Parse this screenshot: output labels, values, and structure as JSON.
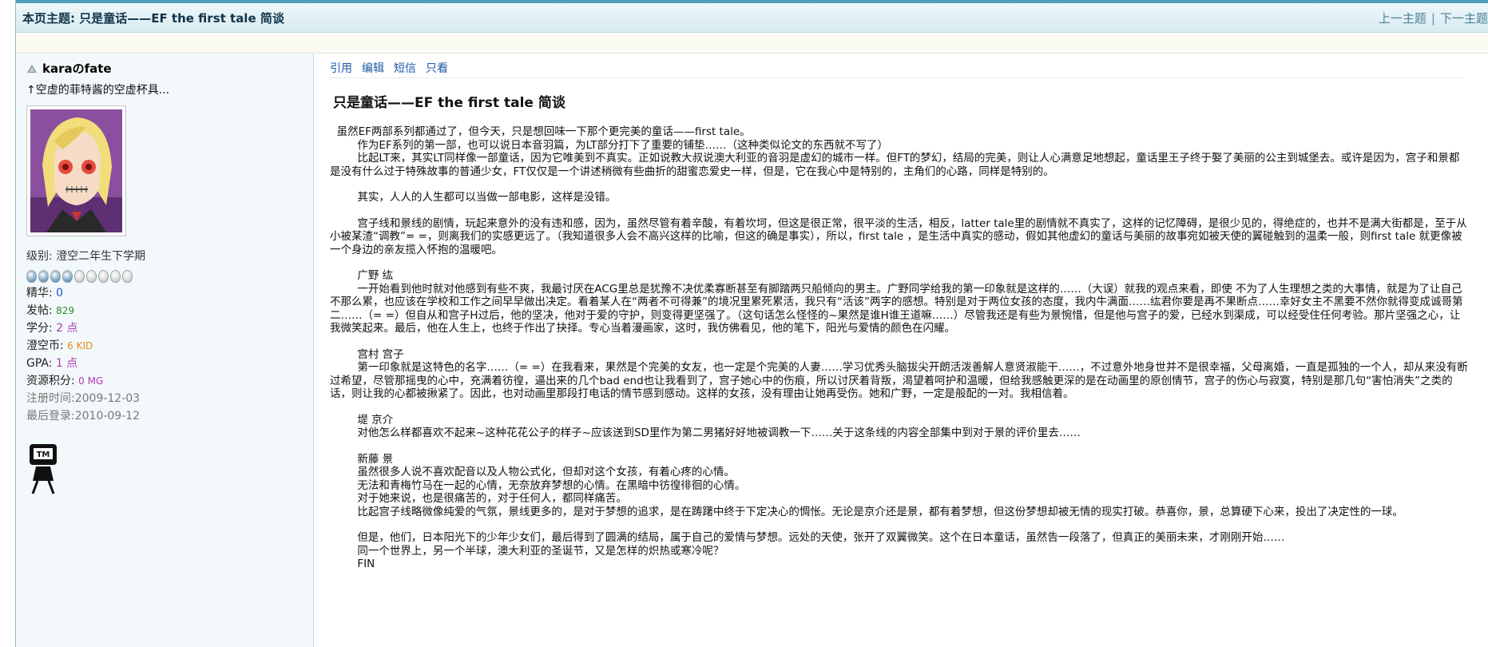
{
  "topbar": {
    "title": "本页主题: 只是童话——EF the first tale 简谈",
    "prev": "上一主题",
    "sep": "|",
    "next": "下一主题"
  },
  "user": {
    "name": "karaのfate",
    "signature": "↑空虚的菲特酱的空虚杯具...",
    "rank": "级别: 澄空二年生下学期",
    "stars_on": 4,
    "stars_total": 9,
    "stats": [
      {
        "label": "精华: ",
        "value": "0"
      },
      {
        "label": "发帖: ",
        "value": "829"
      },
      {
        "label": "学分: ",
        "value": "2 点"
      },
      {
        "label": "澄空币: ",
        "value": "6 KID"
      },
      {
        "label": "GPA: ",
        "value": "1 点"
      },
      {
        "label": "资源积分: ",
        "value": "0 MG"
      }
    ],
    "reg": "注册时间:2009-12-03",
    "last": "最后登录:2010-09-12"
  },
  "actions": [
    "引用",
    "编辑",
    "短信",
    "只看"
  ],
  "post": {
    "title": "只是童话——EF the first tale 简谈",
    "paragraphs": [
      [
        "  虽然EF两部系列都通过了，但今天，只是想回味一下那个更完美的童话——first tale。",
        "        作为EF系列的第一部，也可以说日本音羽篇，为LT部分打下了重要的铺垫……（这种类似论文的东西就不写了）",
        "        比起LT来，其实LT同样像一部童话，因为它唯美到不真实。正如说教大叔说澳大利亚的音羽是虚幻的城市一样。但FT的梦幻，结局的完美，则让人心满意足地想起，童话里王子终于娶了美丽的公主到城堡去。或许是因为，宫子和景都是没有什么过于特殊故事的普通少女，FT仅仅是一个讲述稍微有些曲折的甜蜜恋爱史一样，但是，它在我心中是特别的，主角们的心路，同样是特别的。"
      ],
      [
        "        其实，人人的人生都可以当做一部电影，这样是没错。"
      ],
      [
        "        宫子线和景线的剧情，玩起来意外的没有违和感，因为，虽然尽管有着辛酸，有着坎坷，但这是很正常，很平淡的生活，相反，latter tale里的剧情就不真实了，这样的记忆障碍，是很少见的，得绝症的，也并不是满大街都是，至于从小被某渣“调教”= =，则离我们的实感更远了。（我知道很多人会不高兴这样的比喻，但这的确是事实），所以，first tale ，是生活中真实的感动，假如其他虚幻的童话与美丽的故事宛如被天使的翼碰触到的温柔一般，则first tale 就更像被一个身边的亲友揽入怀抱的温暖吧。"
      ],
      [
        "        广野 纮",
        "        一开始看到他时就对他感到有些不爽，我最讨厌在ACG里总是犹豫不决优柔寡断甚至有脚踏两只船倾向的男主。广野同学给我的第一印象就是这样的……（大误）就我的观点来看，即使 不为了人生理想之类的大事情，就是为了让自己不那么累，也应该在学校和工作之间早早做出决定。看着某人在“两者不可得兼”的境况里累死累活，我只有“活该”两字的感想。特别是对于两位女孩的态度，我内牛满面……纮君你要是再不果断点……幸好女主不黑要不然你就得变成诚哥第二……（= =）但自从和宫子H过后，他的坚决，他对于爱的守护，则变得更坚强了。（这句话怎么怪怪的~果然是谁H谁王道嘛……）尽管我还是有些为景惋惜，但是他与宫子的爱，已经水到渠成，可以经受住任何考验。那片坚强之心，让我微笑起来。最后，他在人生上，也终于作出了抉择。专心当着漫画家，这时，我仿佛看见，他的笔下，阳光与爱情的颜色在闪耀。"
      ],
      [
        "        宫村 宫子",
        "        第一印象就是这特色的名字……（= =）在我看来，果然是个完美的女友，也一定是个完美的人妻……学习优秀头脑拔尖开朗活泼善解人意贤淑能干……，不过意外地身世并不是很幸福，父母离婚，一直是孤独的一个人，却从来没有断过希望，尽管那摇曳的心中，充满着彷徨，逼出来的几个bad end也让我看到了，宫子她心中的伤痕，所以讨厌着背叛，渴望着呵护和温暖，但给我感触更深的是在动画里的原创情节，宫子的伤心与寂寞，特别是那几句“害怕消失”之类的话，则让我的心都被揪紧了。因此，也对动画里那段打电话的情节感到感动。这样的女孩，没有理由让她再受伤。她和广野，一定是般配的一对。我相信着。"
      ],
      [
        "        堤 京介",
        "        对他怎么样都喜欢不起来~这种花花公子的样子~应该送到SD里作为第二男猪好好地被调教一下……关于这条线的内容全部集中到对于景的评价里去……"
      ],
      [
        "        新藤 景",
        "        虽然很多人说不喜欢配音以及人物公式化，但却对这个女孩，有着心疼的心情。",
        "        无法和青梅竹马在一起的心情，无奈放弃梦想的心情。在黑暗中彷徨徘徊的心情。",
        "        对于她来说，也是很痛苦的，对于任何人，都同样痛苦。",
        "        比起宫子线略微像纯爱的气氛，景线更多的，是对于梦想的追求，是在踌躇中终于下定决心的惆怅。无论是京介还是景，都有着梦想，但这份梦想却被无情的现实打破。恭喜你，景，总算硬下心来，投出了决定性的一球。"
      ],
      [
        "        但是，他们，日本阳光下的少年少女们，最后得到了圆满的结局，属于自己的爱情与梦想。远处的天使，张开了双翼微笑。这个在日本童话，虽然告一段落了，但真正的美丽未来，才刚刚开始……",
        "        同一个世界上，另一个半球，澳大利亚的圣诞节，又是怎样的炽热或寒冷呢？",
        "        FIN"
      ]
    ]
  }
}
